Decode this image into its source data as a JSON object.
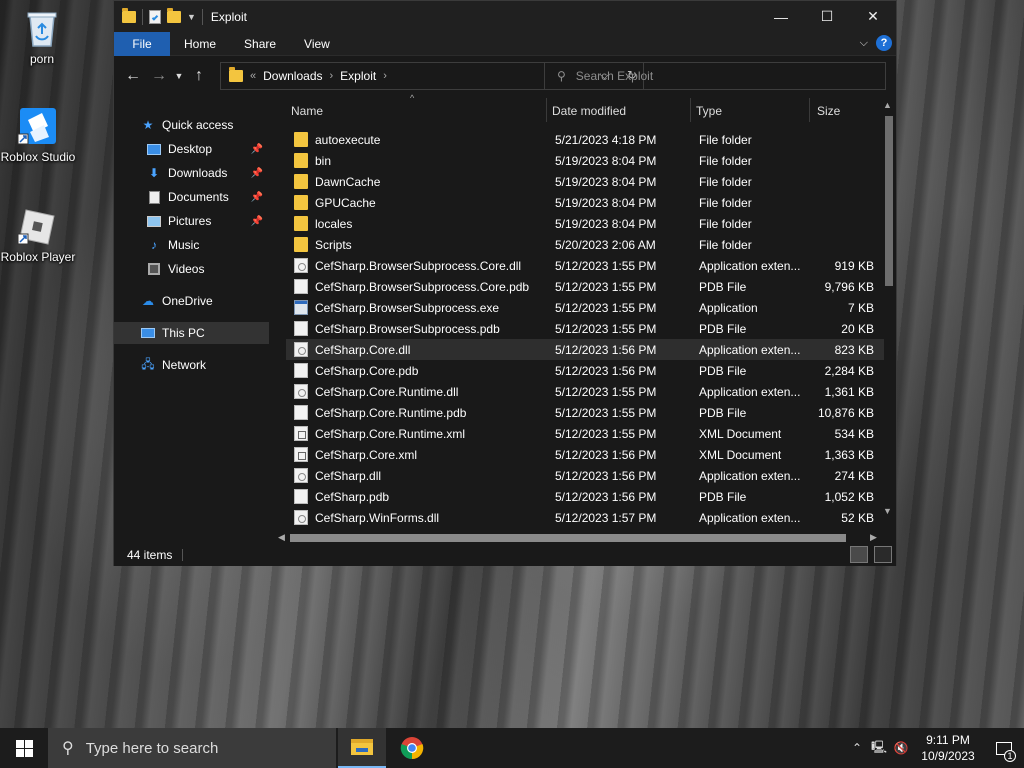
{
  "desktop": {
    "icons": [
      {
        "label": "porn"
      },
      {
        "label": "Roblox Studio"
      },
      {
        "label": "Roblox Player"
      }
    ]
  },
  "window": {
    "title": "Exploit",
    "controls": {
      "minimize": "—",
      "maximize": "☐",
      "close": "✕"
    }
  },
  "ribbon": {
    "tabs": [
      "File",
      "Home",
      "Share",
      "View"
    ],
    "help": "?"
  },
  "address": {
    "overflow": "«",
    "crumbs": [
      "Downloads",
      "Exploit"
    ]
  },
  "search": {
    "placeholder": "Search Exploit"
  },
  "navpane": {
    "items": [
      {
        "label": "Quick access"
      },
      {
        "label": "Desktop"
      },
      {
        "label": "Downloads"
      },
      {
        "label": "Documents"
      },
      {
        "label": "Pictures"
      },
      {
        "label": "Music"
      },
      {
        "label": "Videos"
      },
      {
        "label": "OneDrive"
      },
      {
        "label": "This PC"
      },
      {
        "label": "Network"
      }
    ]
  },
  "columns": {
    "name": "Name",
    "date": "Date modified",
    "type": "Type",
    "size": "Size"
  },
  "files": [
    {
      "name": "autoexecute",
      "date": "5/21/2023 4:18 PM",
      "type": "File folder",
      "size": ""
    },
    {
      "name": "bin",
      "date": "5/19/2023 8:04 PM",
      "type": "File folder",
      "size": ""
    },
    {
      "name": "DawnCache",
      "date": "5/19/2023 8:04 PM",
      "type": "File folder",
      "size": ""
    },
    {
      "name": "GPUCache",
      "date": "5/19/2023 8:04 PM",
      "type": "File folder",
      "size": ""
    },
    {
      "name": "locales",
      "date": "5/19/2023 8:04 PM",
      "type": "File folder",
      "size": ""
    },
    {
      "name": "Scripts",
      "date": "5/20/2023 2:06 AM",
      "type": "File folder",
      "size": ""
    },
    {
      "name": "CefSharp.BrowserSubprocess.Core.dll",
      "date": "5/12/2023 1:55 PM",
      "type": "Application exten...",
      "size": "919 KB"
    },
    {
      "name": "CefSharp.BrowserSubprocess.Core.pdb",
      "date": "5/12/2023 1:55 PM",
      "type": "PDB File",
      "size": "9,796 KB"
    },
    {
      "name": "CefSharp.BrowserSubprocess.exe",
      "date": "5/12/2023 1:55 PM",
      "type": "Application",
      "size": "7 KB"
    },
    {
      "name": "CefSharp.BrowserSubprocess.pdb",
      "date": "5/12/2023 1:55 PM",
      "type": "PDB File",
      "size": "20 KB"
    },
    {
      "name": "CefSharp.Core.dll",
      "date": "5/12/2023 1:56 PM",
      "type": "Application exten...",
      "size": "823 KB"
    },
    {
      "name": "CefSharp.Core.pdb",
      "date": "5/12/2023 1:56 PM",
      "type": "PDB File",
      "size": "2,284 KB"
    },
    {
      "name": "CefSharp.Core.Runtime.dll",
      "date": "5/12/2023 1:55 PM",
      "type": "Application exten...",
      "size": "1,361 KB"
    },
    {
      "name": "CefSharp.Core.Runtime.pdb",
      "date": "5/12/2023 1:55 PM",
      "type": "PDB File",
      "size": "10,876 KB"
    },
    {
      "name": "CefSharp.Core.Runtime.xml",
      "date": "5/12/2023 1:55 PM",
      "type": "XML Document",
      "size": "534 KB"
    },
    {
      "name": "CefSharp.Core.xml",
      "date": "5/12/2023 1:56 PM",
      "type": "XML Document",
      "size": "1,363 KB"
    },
    {
      "name": "CefSharp.dll",
      "date": "5/12/2023 1:56 PM",
      "type": "Application exten...",
      "size": "274 KB"
    },
    {
      "name": "CefSharp.pdb",
      "date": "5/12/2023 1:56 PM",
      "type": "PDB File",
      "size": "1,052 KB"
    },
    {
      "name": "CefSharp.WinForms.dll",
      "date": "5/12/2023 1:57 PM",
      "type": "Application exten...",
      "size": "52 KB"
    }
  ],
  "status": {
    "items": "44 items"
  },
  "taskbar": {
    "search_placeholder": "Type here to search",
    "time": "9:11 PM",
    "date": "10/9/2023",
    "notifications": "1"
  }
}
